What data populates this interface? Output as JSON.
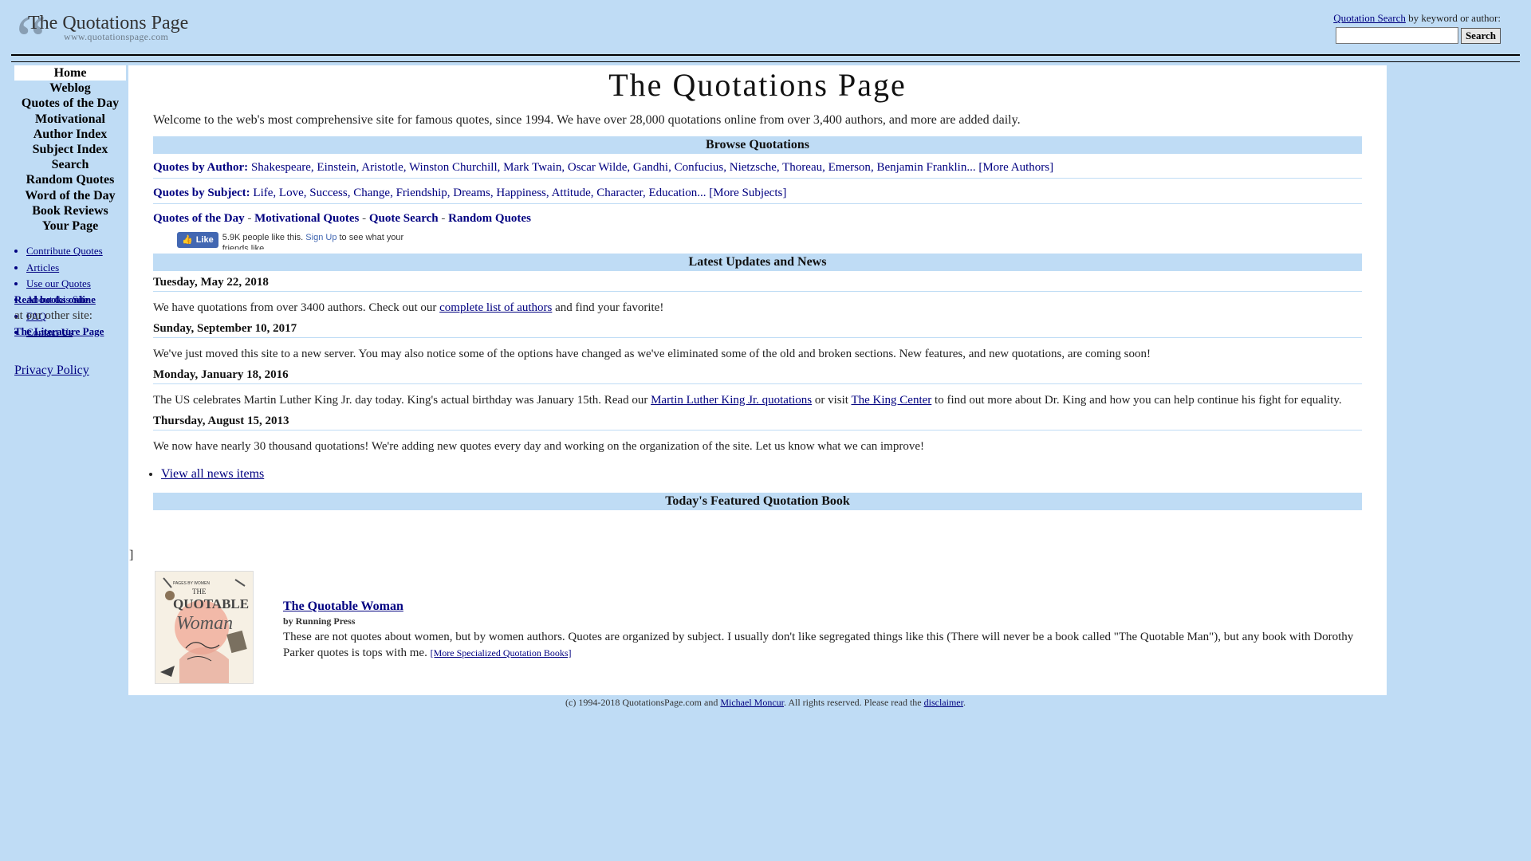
{
  "header": {
    "logo_title": "The Quotations Page",
    "logo_url": "www.quotationspage.com",
    "search_link": "Quotation Search",
    "search_suffix": " by keyword or author:",
    "search_value": "",
    "search_button": "Search"
  },
  "sidebar": {
    "nav": [
      {
        "label": "Home",
        "active": true
      },
      {
        "label": "Weblog"
      },
      {
        "label": "Quotes of the Day"
      },
      {
        "label": "Motivational"
      },
      {
        "label": "Author Index"
      },
      {
        "label": "Subject Index"
      },
      {
        "label": "Search"
      },
      {
        "label": "Random Quotes"
      },
      {
        "label": "Word of the Day"
      },
      {
        "label": "Book Reviews"
      },
      {
        "label": "Your Page"
      }
    ],
    "subnav": [
      "Contribute Quotes",
      "Articles",
      "Use our Quotes",
      "About this Site",
      "FAQ",
      "Contact Us"
    ],
    "read_books": "Read books online",
    "other_site": "at our other site:",
    "lit_page": "The Literature Page",
    "privacy": "Privacy Policy"
  },
  "main": {
    "title": "The Quotations Page",
    "intro": "Welcome to the web's most comprehensive site for famous quotes, since 1994. We have over 28,000 quotations online from over 3,400 authors, and more are added daily.",
    "browse_heading": "Browse Quotations",
    "by_author_label": "Quotes by Author:",
    "authors": [
      "Shakespeare",
      "Einstein",
      "Aristotle",
      "Winston Churchill",
      "Mark Twain",
      "Oscar Wilde",
      "Gandhi",
      "Confucius",
      "Nietzsche",
      "Thoreau",
      "Emerson",
      "Benjamin Franklin..."
    ],
    "more_authors": "[More Authors]",
    "by_subject_label": "Quotes by Subject:",
    "subjects": [
      "Life",
      "Love",
      "Success",
      "Change",
      "Friendship",
      "Dreams",
      "Happiness",
      "Attitude",
      "Character",
      "Education..."
    ],
    "more_subjects": "[More Subjects]",
    "qod_links": [
      "Quotes of the Day",
      "Motivational Quotes",
      "Quote Search",
      "Random Quotes"
    ],
    "fb": {
      "button": "Like",
      "count_text": "5.9K people like this.",
      "signup": "Sign Up",
      "rest": "to see what your friends like."
    },
    "news_heading": "Latest Updates and News",
    "news": [
      {
        "date": "Tuesday, May 22, 2018",
        "pre": "We have quotations from over 3400 authors. Check out our ",
        "link": "complete list of authors",
        "post": " and find your favorite!"
      },
      {
        "date": "Sunday, September 10, 2017",
        "pre": "We've just moved this site to a new server. You may also notice some of the options have changed as we've eliminated some of the old and broken sections. New features, and new quotations, are coming soon!"
      },
      {
        "date": "Monday, January 18, 2016",
        "pre": "The US celebrates Martin Luther King Jr. day today. King's actual birthday was January 15th. Read our ",
        "link": "Martin Luther King Jr. quotations",
        "mid": " or visit ",
        "link2": "The King Center",
        "post": " to find out more about Dr. King and how you can help continue his fight for equality."
      },
      {
        "date": "Thursday, August 15, 2013",
        "pre": "We now have nearly 30 thousand quotations! We're adding new quotes every day and working on the organization of the site. Let us know what we can improve!"
      }
    ],
    "view_all_news": "View all news items",
    "featured_heading": "Today's Featured Quotation Book",
    "stray_bracket": "]",
    "book": {
      "title": "The Quotable Woman",
      "author": "by Running Press",
      "desc": "These are not quotes about women, but by women authors. Quotes are organized by subject. I usually don't like segregated things like this (There will never be a book called \"The Quotable Man\"), but any book with Dorothy Parker quotes is tops with me.",
      "more": "[More Specialized Quotation Books]",
      "cover_top": "PAGES BY WOMEN",
      "cover_the": "THE",
      "cover_quotable": "QUOTABLE",
      "cover_woman": "Woman"
    }
  },
  "footer": {
    "pre": "(c) 1994-2018 QuotationsPage.com and ",
    "link1": "Michael Moncur",
    "mid": ". All rights reserved. Please read the ",
    "link2": "disclaimer",
    "post": "."
  }
}
